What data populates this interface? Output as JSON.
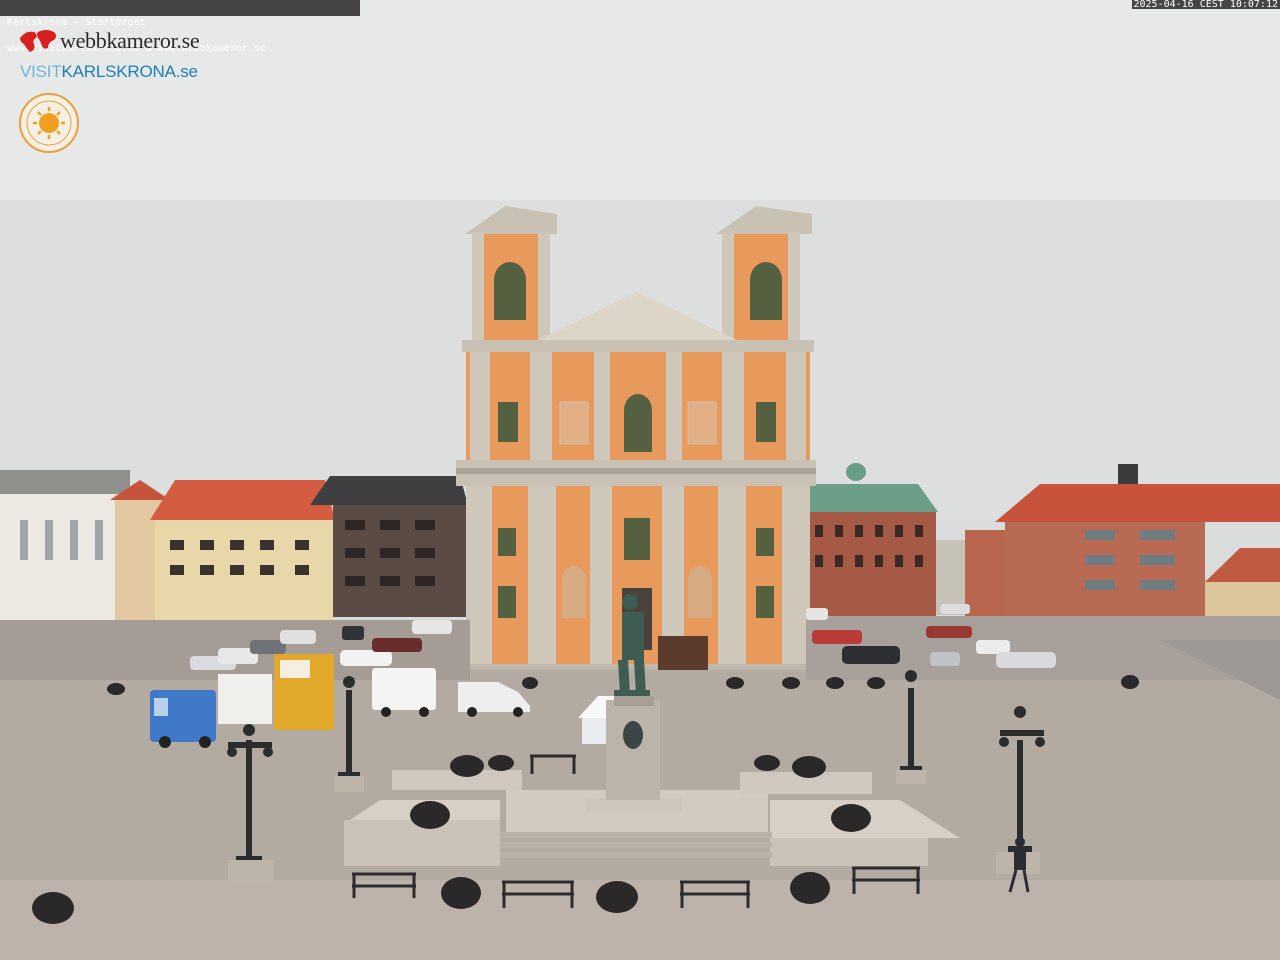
{
  "caption": {
    "line1": "Karlskrona - Stortorget",
    "line2": "www.visitkarlskrona.se & www.webbkameror.se",
    "timestamp": "2025-04-16 CEST 10:07:12"
  },
  "logos": {
    "webbkameror": "webbkameror.se",
    "visit_prefix": "VISIT",
    "visit_name": "KARLSKRONA",
    "visit_suffix": ".se",
    "solig_badge": "SVERIGES SOLIGASTE STAD · KARLSKRONA"
  },
  "colors": {
    "sky": "#dfe2e1",
    "church_facade": "#e89a5c",
    "church_stone": "#c9c2b4",
    "roof_red": "#c8533c",
    "roof_green": "#6a9e86",
    "square": "#b4aba3"
  }
}
